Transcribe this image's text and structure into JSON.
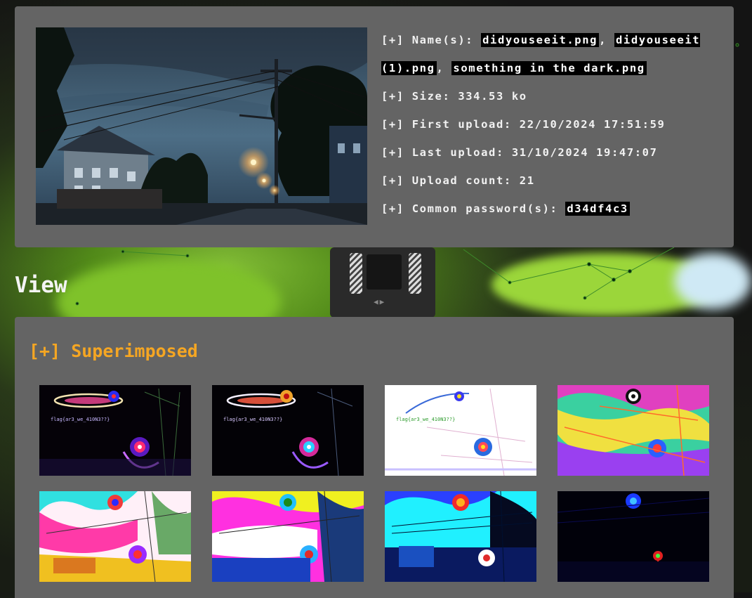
{
  "file_info": {
    "names_label": "[+] Name(s):",
    "names": [
      "didyouseeit.png",
      "didyouseeit (1).png",
      "something in the dark.png"
    ],
    "separator": ",",
    "size": "[+] Size: 334.53 ko",
    "first_upload": "[+] First upload: 22/10/2024 17:51:59",
    "last_upload": "[+] Last upload: 31/10/2024 19:47:07",
    "upload_count": "[+] Upload count: 21",
    "password_label": "[+] Common password(s):",
    "password": "d34df4c3"
  },
  "view": {
    "title": "View",
    "section_title": "[+] Superimposed",
    "flag_text": "flag{ar3_we_410N3??}"
  },
  "colors": {
    "panel": "#646464",
    "accent": "#f5a623",
    "highlight_bg": "#000000"
  }
}
